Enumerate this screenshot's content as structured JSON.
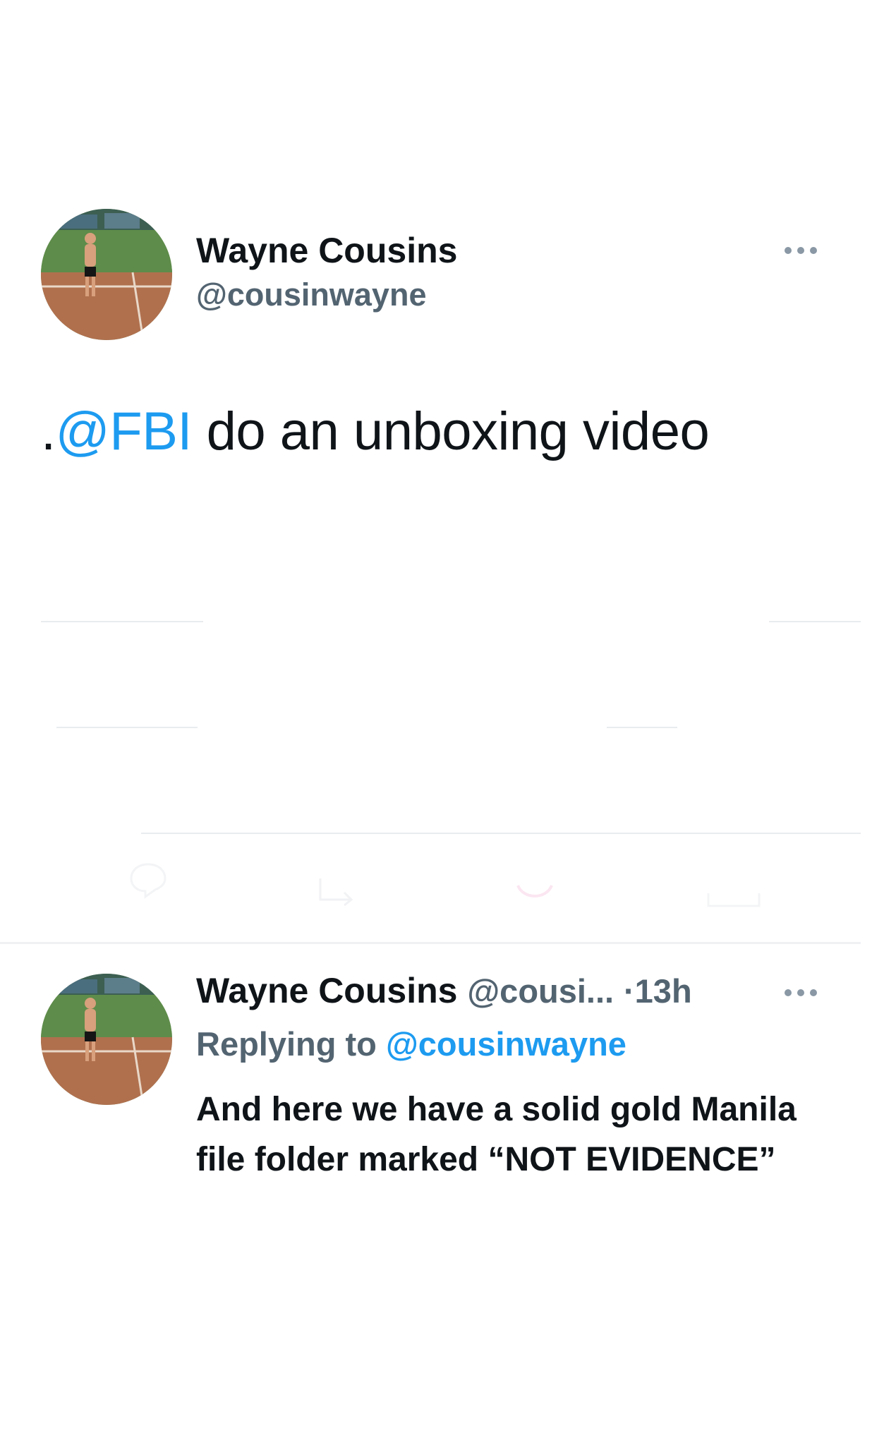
{
  "main_tweet": {
    "author_name": "Wayne Cousins",
    "author_handle": "@cousinwayne",
    "text_prefix": ".",
    "mention": "@FBI",
    "text_rest": " do an unboxing video"
  },
  "reply_tweet": {
    "author_name": "Wayne Cousins",
    "author_handle_truncated": "@cousi...",
    "separator": "·",
    "time_ago": "13h",
    "replying_label": "Replying to",
    "replying_to": "@cousinwayne",
    "text": "And here we have a solid gold Manila file folder marked “NOT EVIDENCE”"
  },
  "icons": {
    "more": "more-horizontal-icon",
    "reply": "reply-icon",
    "retweet": "retweet-icon",
    "like": "like-icon",
    "share": "share-icon"
  },
  "colors": {
    "link": "#1d9bf0",
    "secondary_text": "#536471",
    "primary_text": "#0f1419"
  }
}
